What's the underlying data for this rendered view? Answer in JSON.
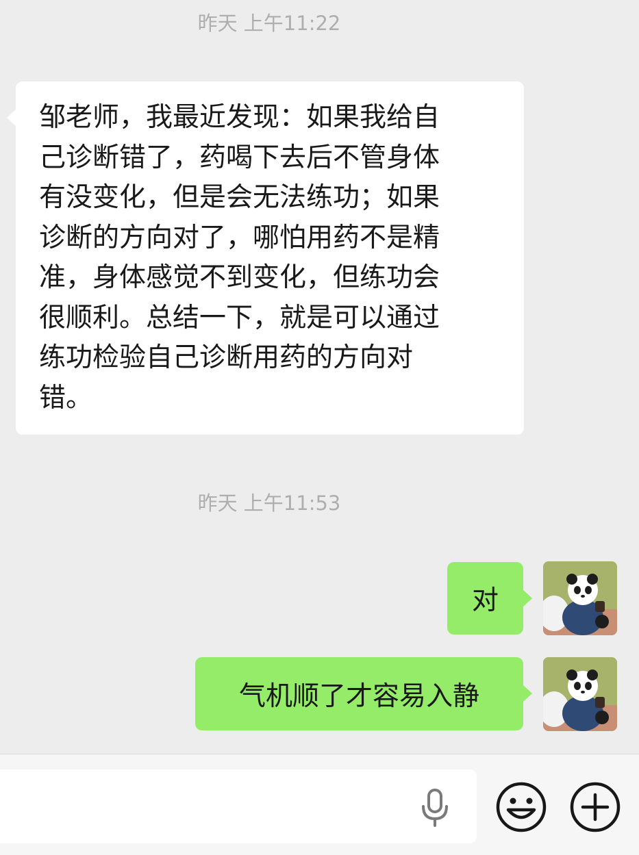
{
  "chat": {
    "messages": [
      {
        "timestamp": "昨天 上午11:22",
        "direction": "incoming",
        "lines": [
          "邹老师，我最近发现：如果我给自",
          "己诊断错了，药喝下去后不管身体",
          "有没变化，但是会无法练功；如果",
          "诊断的方向对了，哪怕用药不是精",
          "准，身体感觉不到变化，但练功会",
          "很顺利。总结一下，就是可以通过",
          "练功检验自己诊断用药的方向对",
          "错。"
        ]
      },
      {
        "timestamp": "昨天 上午11:53",
        "direction": "outgoing",
        "text": "对"
      },
      {
        "direction": "outgoing",
        "text": "气机顺了才容易入静"
      }
    ]
  },
  "input_bar": {
    "mic_icon": "microphone-icon",
    "emoji_icon": "smiley-face-icon",
    "plus_icon": "plus-circle-icon"
  },
  "colors": {
    "background": "#ededed",
    "incoming_bubble": "#ffffff",
    "outgoing_bubble": "#95ec69",
    "timestamp_text": "#aeaeae"
  }
}
